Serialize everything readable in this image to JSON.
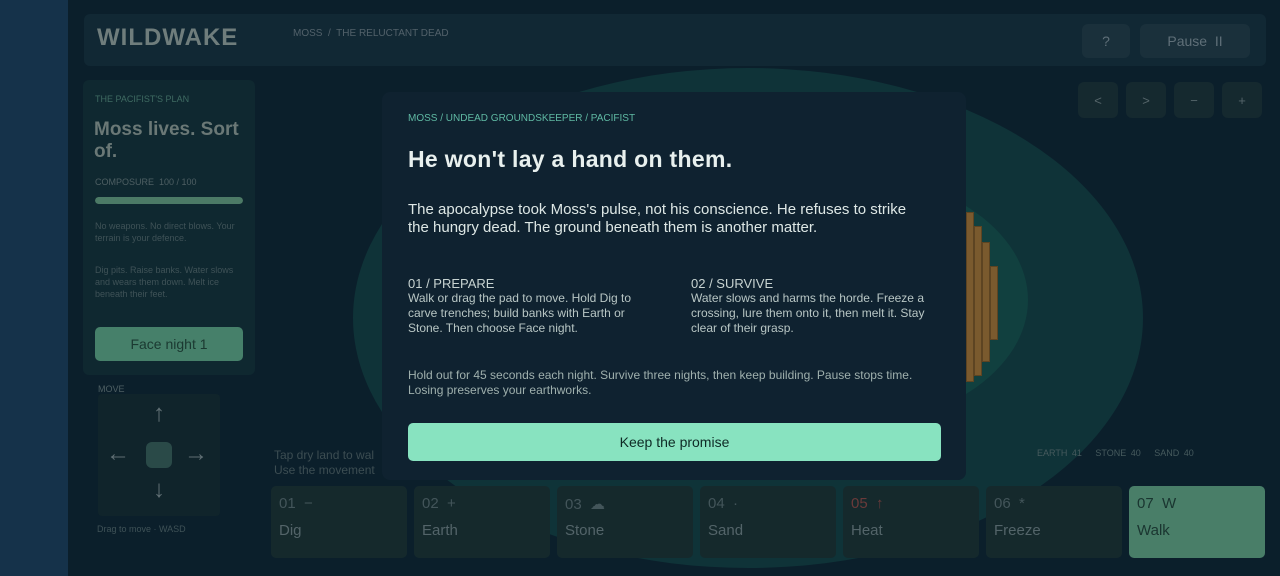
{
  "header": {
    "brand": "WILDWAKE",
    "breadcrumb": "MOSS  /  THE RELUCTANT DEAD",
    "help_label": "?",
    "pause_label": "Pause  II"
  },
  "view_controls": [
    "<",
    ">",
    "−",
    "+"
  ],
  "plan": {
    "tag": "THE PACIFIST'S PLAN",
    "title": "Moss lives. Sort of.",
    "composure_label": "COMPOSURE  100 / 100",
    "composure": 1.0,
    "note1": "No weapons. No direct blows. Your terrain is your defence.",
    "note2": "Dig pits. Raise banks. Water slows and wears them down. Melt ice beneath their feet.",
    "button": "Face night 1"
  },
  "move": {
    "label": "MOVE",
    "hint": "Drag to move  ·  WASD",
    "icons": [
      "arrow-up-icon",
      "arrow-left-icon",
      "arrow-right-icon",
      "arrow-down-icon"
    ]
  },
  "hint_text": {
    "line1": "Tap dry land to wal",
    "line2": "Use the movement"
  },
  "resources": "EARTH 41   STONE 40   SAND 40",
  "tools": [
    {
      "num": "01  −",
      "name": "Dig"
    },
    {
      "num": "02  +",
      "name": "Earth"
    },
    {
      "num": "03  ☁",
      "name": "Stone"
    },
    {
      "num": "04  ·",
      "name": "Sand"
    },
    {
      "num": "05  ↑",
      "name": "Heat"
    },
    {
      "num": "06  *",
      "name": "Freeze"
    },
    {
      "num": "07  W",
      "name": "Walk"
    }
  ],
  "modal": {
    "tag": "MOSS / UNDEAD GROUNDSKEEPER / PACIFIST",
    "title": "He won't lay a hand on them.",
    "lead": "The apocalypse took Moss's pulse, not his conscience. He refuses to strike the hungry dead. The ground beneath them is another matter.",
    "col1_head": "01 / PREPARE",
    "col1_body": "Walk or drag the pad to move. Hold Dig to carve trenches; build banks with Earth or Stone. Then choose Face night.",
    "col2_head": "02 / SURVIVE",
    "col2_body": "Water slows and harms the horde. Freeze a crossing, lure them onto it, then melt it. Stay clear of their grasp.",
    "footer": "Hold out for 45 seconds each night. Survive three nights, then keep building. Pause stops time. Losing preserves your earthworks.",
    "button": "Keep the promise"
  }
}
